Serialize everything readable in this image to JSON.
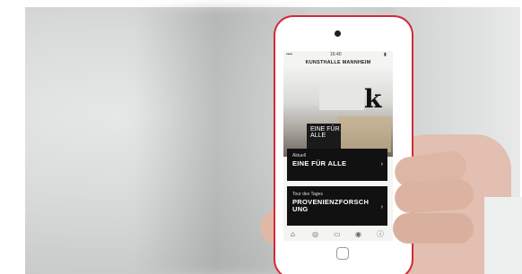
{
  "photo": {
    "description_free": true
  },
  "app": {
    "status_time": "16:40",
    "status_signal": "••••",
    "status_battery": "▮",
    "title": "KUNSTHALLE MANNHEIM",
    "logo": "k",
    "hero_label_line1": "EINE FÜR",
    "hero_label_line2": "ALLE",
    "card1": {
      "kicker": "Aktuell",
      "headline": "EINE FÜR ALLE",
      "chevron": "›"
    },
    "card2": {
      "kicker": "Tour des Tages",
      "headline": "PROVENIENZFORSCH UNG",
      "chevron": "›"
    },
    "tabs": [
      {
        "icon": "home-icon",
        "glyph": "⌂"
      },
      {
        "icon": "compass-icon",
        "glyph": "◎"
      },
      {
        "icon": "book-icon",
        "glyph": "▭"
      },
      {
        "icon": "eye-icon",
        "glyph": "◉"
      },
      {
        "icon": "info-icon",
        "glyph": "ⓘ"
      }
    ]
  }
}
